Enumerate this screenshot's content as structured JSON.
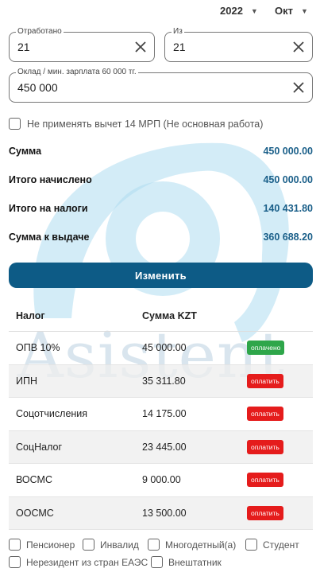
{
  "period": {
    "year": "2022",
    "month": "Окт"
  },
  "fields": {
    "worked": {
      "label": "Отработано",
      "value": "21"
    },
    "of": {
      "label": "Из",
      "value": "21"
    },
    "salary": {
      "label": "Оклад / мин. зарплата 60 000 тг.",
      "value": "450 000"
    }
  },
  "deduction_checkbox": {
    "label": "Не применять вычет 14 МРП (Не основная работа)",
    "checked": false
  },
  "summary": [
    {
      "label": "Сумма",
      "value": "450 000.00"
    },
    {
      "label": "Итого начислено",
      "value": "450 000.00"
    },
    {
      "label": "Итого на налоги",
      "value": "140 431.80"
    },
    {
      "label": "Сумма к выдаче",
      "value": "360 688.20"
    }
  ],
  "change_button": "Изменить",
  "table": {
    "headers": {
      "tax": "Налог",
      "amount": "Сумма KZT"
    },
    "rows": [
      {
        "tax": "ОПВ 10%",
        "amount": "45 000.00",
        "status": "оплачено",
        "status_type": "paid"
      },
      {
        "tax": "ИПН",
        "amount": "35 311.80",
        "status": "оплатить",
        "status_type": "pay"
      },
      {
        "tax": "Соцотчисления",
        "amount": "14 175.00",
        "status": "оплатить",
        "status_type": "pay"
      },
      {
        "tax": "СоцНалог",
        "amount": "23 445.00",
        "status": "оплатить",
        "status_type": "pay"
      },
      {
        "tax": "ВОСМС",
        "amount": "9 000.00",
        "status": "оплатить",
        "status_type": "pay"
      },
      {
        "tax": "ООСМС",
        "amount": "13 500.00",
        "status": "оплатить",
        "status_type": "pay"
      }
    ]
  },
  "categories": [
    {
      "label": "Пенсионер",
      "checked": false
    },
    {
      "label": "Инвалид",
      "checked": false
    },
    {
      "label": "Многодетный(а)",
      "checked": false
    },
    {
      "label": "Студент",
      "checked": false
    },
    {
      "label": "Нерезидент из стран ЕАЭС",
      "checked": false
    },
    {
      "label": "Внештатник",
      "checked": false
    }
  ],
  "watermark": {
    "text": "Asistent"
  },
  "colors": {
    "primary": "#0d5b86",
    "value_blue": "#1a5f89",
    "paid": "#2ea64a",
    "pay": "#e51c1c",
    "watermark": "#bfe3f2"
  }
}
